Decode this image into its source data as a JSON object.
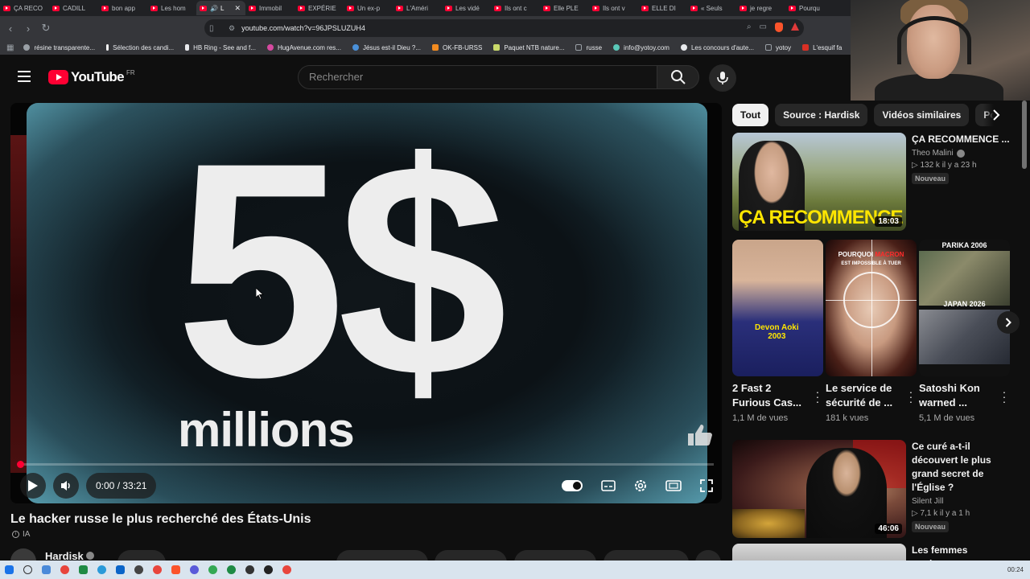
{
  "browser": {
    "tabs": [
      {
        "label": "ÇA RECO",
        "active": false
      },
      {
        "label": "CADILL",
        "active": false
      },
      {
        "label": "bon app",
        "active": false
      },
      {
        "label": "Les hom",
        "active": false
      },
      {
        "label": "L",
        "active": true
      },
      {
        "label": "Immobil",
        "active": false
      },
      {
        "label": "EXPÉRIE",
        "active": false
      },
      {
        "label": "Un ex-p",
        "active": false
      },
      {
        "label": "L'Améri",
        "active": false
      },
      {
        "label": "Les vidé",
        "active": false
      },
      {
        "label": "Ils ont c",
        "active": false
      },
      {
        "label": "Elle PLE",
        "active": false
      },
      {
        "label": "Ils ont v",
        "active": false
      },
      {
        "label": "ELLE DI",
        "active": false
      },
      {
        "label": "« Seuls",
        "active": false
      },
      {
        "label": "je regre",
        "active": false
      },
      {
        "label": "Pourqu",
        "active": false
      }
    ],
    "url": "youtube.com/watch?v=96JPSLUZUH4",
    "bookmarks": [
      {
        "label": "résine transparente...",
        "color": "#9aa0a6"
      },
      {
        "label": "Sélection des candi...",
        "color": "#f4f4f4"
      },
      {
        "label": "HB Ring - See and f...",
        "color": "#e8eaed"
      },
      {
        "label": "HugAvenue.com res...",
        "color": "#d64aa0"
      },
      {
        "label": "Jésus est-il Dieu ?...",
        "color": "#4a90d9"
      },
      {
        "label": "OK-FB-URSS",
        "color": "#f28b20"
      },
      {
        "label": "Paquet NTB nature...",
        "color": "#c9d96a"
      },
      {
        "label": "russe",
        "color": "#9aa0a6"
      },
      {
        "label": "info@yotoy.com",
        "color": "#5ac8b8"
      },
      {
        "label": "Les concours d'aute...",
        "color": "#e8eaed"
      },
      {
        "label": "yotoy",
        "color": "#9aa0a6"
      },
      {
        "label": "L'esquif fa",
        "color": "#d93025"
      }
    ]
  },
  "youtube": {
    "logo_text": "YouTube",
    "country_code": "FR",
    "search_placeholder": "Rechercher"
  },
  "player": {
    "frame_main": "5$",
    "frame_sub": "millions",
    "time_display": "0:00 / 33:21",
    "progress": 0
  },
  "video": {
    "title": "Le hacker russe le plus recherché des États-Unis",
    "ai_label": "IA",
    "channel": "Hardisk"
  },
  "chips": [
    "Tout",
    "Source : Hardisk",
    "Vidéos similaires",
    "Po"
  ],
  "recommendations": [
    {
      "title": "ÇA RECOMMENCE ...",
      "channel": "Theo Malini",
      "meta": "▷ 132 k   il y a 23 h",
      "badge": "Nouveau",
      "duration": "18:03",
      "thumb_caption_a": "ÇA",
      "thumb_caption_b": "RECOMMENCE"
    },
    {
      "title": "Ce curé a-t-il découvert le plus grand secret de l'Église ?",
      "channel": "Silent Jill",
      "meta": "▷ 7,1 k   il y a 1 h",
      "badge": "Nouveau",
      "duration": "46:06"
    },
    {
      "title": "Les femmes modernes"
    }
  ],
  "shorts": [
    {
      "title": "2 Fast 2 Furious Cas...",
      "views": "1,1 M de vues",
      "thumb_text_1": "Devon Aoki",
      "thumb_text_2": "2003"
    },
    {
      "title": "Le service de sécurité de ...",
      "views": "181 k vues",
      "thumb_text_1": "POURQUOI",
      "thumb_text_2": "MACRON",
      "thumb_text_3": "EST IMPOSSIBLE À TUER"
    },
    {
      "title": "Satoshi Kon warned ...",
      "views": "5,1 M de vues",
      "thumb_text_1": "PARIKA 2006",
      "thumb_text_2": "JAPAN 2026"
    }
  ],
  "taskbar": {
    "time": "00:24"
  }
}
